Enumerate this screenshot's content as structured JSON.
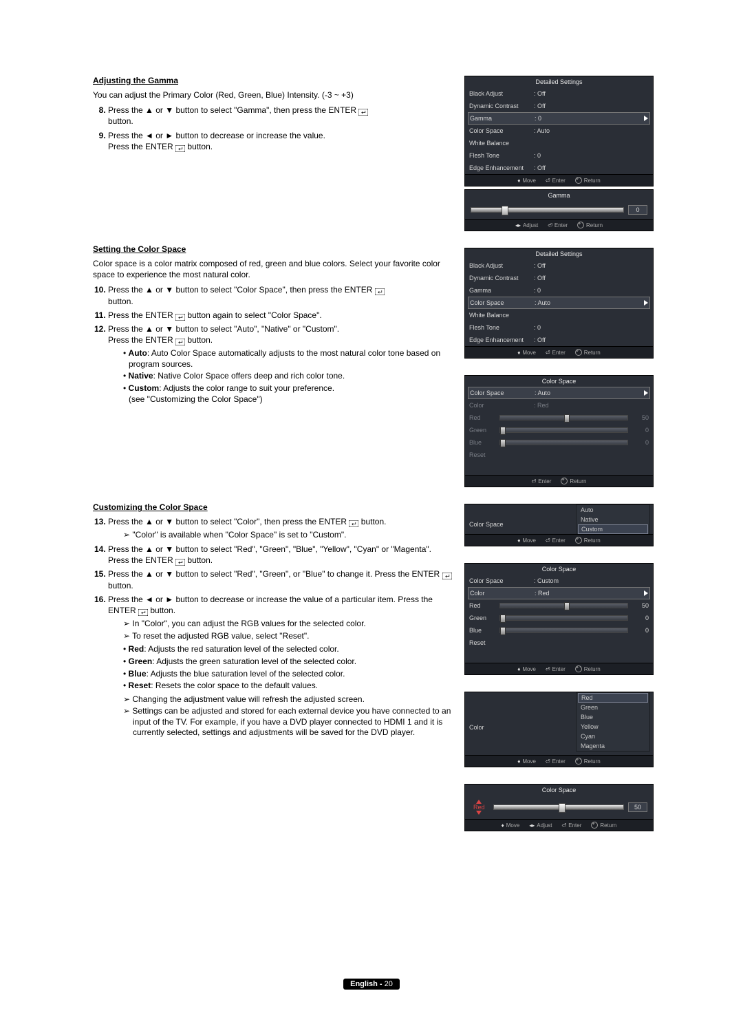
{
  "sections": {
    "gamma": {
      "title": "Adjusting the Gamma",
      "intro": "You can adjust the Primary Color (Red, Green, Blue) Intensity. (-3 ~ +3)",
      "step8": "Press the ▲ or ▼ button to select \"Gamma\", then press the ENTER",
      "step8b": "button.",
      "step9a": "Press the ◄ or ► button to decrease or increase the value.",
      "step9b": "Press the ENTER",
      "step9c": " button."
    },
    "colorspace": {
      "title": "Setting the Color Space",
      "intro": "Color space is a color matrix composed of red, green and blue colors. Select your favorite color space to experience the most natural color.",
      "step10": "Press the ▲ or ▼ button to select \"Color Space\", then press the ENTER",
      "step10b": "button.",
      "step11a": "Press the ENTER",
      "step11b": " button again to select \"Color Space\".",
      "step12a": "Press the ▲ or ▼ button to select \"Auto\", \"Native\" or \"Custom\".",
      "step12b": "Press the ENTER",
      "step12c": " button.",
      "b_auto": "Auto: Auto Color Space automatically adjusts to the most natural color tone based on program sources.",
      "b_native": "Native: Native Color Space offers deep and rich color tone.",
      "b_custom": "Custom: Adjusts the color range to suit your preference.",
      "b_custom2": "(see \"Customizing the Color Space\")"
    },
    "customize": {
      "title": "Customizing the Color Space",
      "step13a": "Press the ▲ or ▼ button to select \"Color\", then press the ENTER",
      "step13b": " button.",
      "step13note": "\"Color\" is available when \"Color Space\" is set to \"Custom\".",
      "step14": "Press the ▲ or ▼ button to select \"Red\", \"Green\", \"Blue\", \"Yellow\", \"Cyan\" or \"Magenta\". Press the ENTER",
      "step14b": " button.",
      "step15": "Press the ▲ or ▼ button to select \"Red\", \"Green\", or \"Blue\" to change it. Press the ENTER",
      "step15b": " button.",
      "step16": "Press the ◄ or ► button to decrease or increase the value of a particular item. Press the ENTER",
      "step16b": " button.",
      "note_rgb": "In \"Color\", you can adjust the RGB values for the selected color.",
      "note_reset": "To reset the adjusted RGB value, select \"Reset\".",
      "b_red": "Red: Adjusts the red saturation level of the selected color.",
      "b_green": "Green: Adjusts the green saturation level of the selected color.",
      "b_blue": "Blue: Adjusts the blue saturation level of the selected color.",
      "b_resetv": "Reset: Resets the color space to the default values.",
      "note_refresh": "Changing the adjustment value will refresh the adjusted screen.",
      "note_device": "Settings can be adjusted and stored for each external device you have connected to an input of the TV. For example, if you have a DVD player connected to HDMI 1 and it is currently selected, settings and adjustments will be saved for the DVD player."
    }
  },
  "osd": {
    "detailed_title": "Detailed Settings",
    "rows": {
      "black_adjust": {
        "label": "Black Adjust",
        "value": ": Off"
      },
      "dyn_contrast": {
        "label": "Dynamic Contrast",
        "value": ": Off"
      },
      "gamma": {
        "label": "Gamma",
        "value": ": 0"
      },
      "color_space": {
        "label": "Color Space",
        "value": ": Auto"
      },
      "white_balance": {
        "label": "White Balance",
        "value": ""
      },
      "flesh_tone": {
        "label": "Flesh Tone",
        "value": ": 0"
      },
      "edge_enh": {
        "label": "Edge Enhancement",
        "value": ": Off"
      }
    },
    "gamma_panel": {
      "title": "Gamma",
      "value": "0",
      "thumb_pct": 20
    },
    "cs_panel_title": "Color Space",
    "cs_row_csp": {
      "label": "Color Space",
      "value": ": Auto"
    },
    "cs_row_color": {
      "label": "Color",
      "value": ": Red"
    },
    "cs_row_red": {
      "label": "Red",
      "value": "50",
      "thumb_pct": 50
    },
    "cs_row_green": {
      "label": "Green",
      "value": "0",
      "thumb_pct": 0
    },
    "cs_row_blue": {
      "label": "Blue",
      "value": "0",
      "thumb_pct": 0
    },
    "cs_row_reset": {
      "label": "Reset"
    },
    "cs_dropdown_label": "Color Space",
    "cs_dropdown_opts": {
      "auto": "Auto",
      "native": "Native",
      "custom": "Custom"
    },
    "cs_custom_csp": {
      "label": "Color Space",
      "value": ": Custom"
    },
    "cs_custom_color": {
      "label": "Color",
      "value": ": Red"
    },
    "color_dropdown_label": "Color",
    "color_opts": {
      "red": "Red",
      "green": "Green",
      "blue": "Blue",
      "yellow": "Yellow",
      "cyan": "Cyan",
      "magenta": "Magenta"
    },
    "red_adjust": {
      "label": "Red",
      "value": "50",
      "thumb_pct": 50
    }
  },
  "hints": {
    "move": "Move",
    "adjust": "Adjust",
    "enter": "Enter",
    "ret": "Return"
  },
  "footer": {
    "lang": "English - ",
    "page": "20"
  }
}
